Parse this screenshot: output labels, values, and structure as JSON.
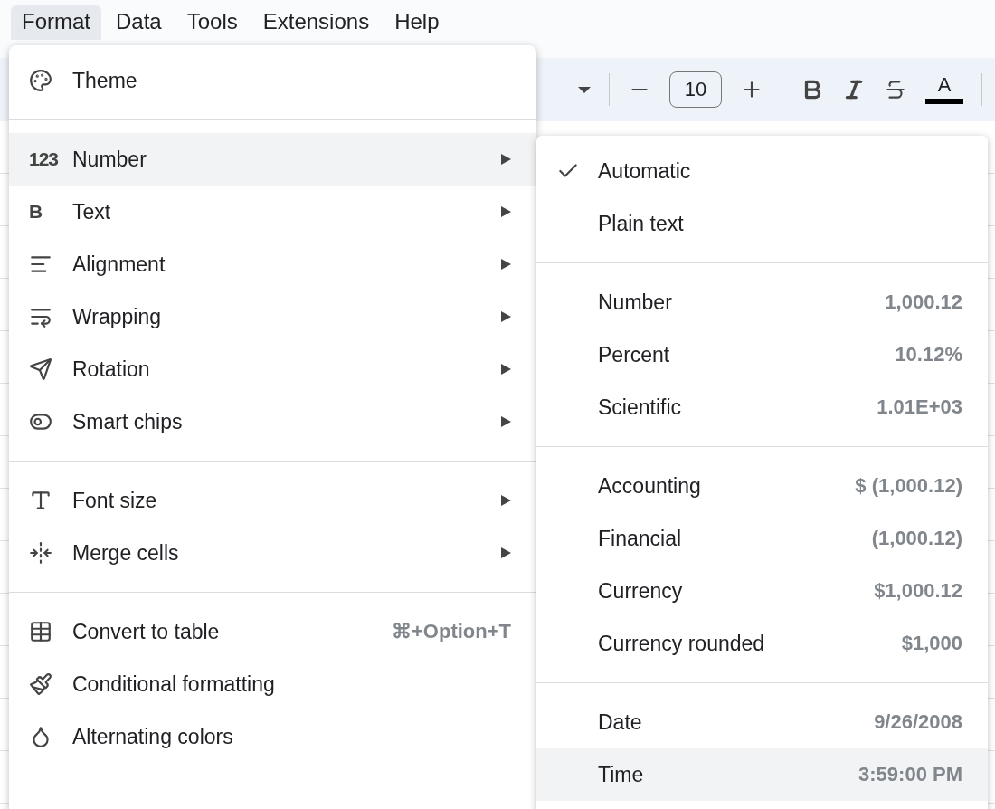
{
  "menubar": [
    {
      "label": "Format",
      "selected": true
    },
    {
      "label": "Data",
      "selected": false
    },
    {
      "label": "Tools",
      "selected": false
    },
    {
      "label": "Extensions",
      "selected": false
    },
    {
      "label": "Help",
      "selected": false
    }
  ],
  "toolbar": {
    "font_size": "10",
    "text_color_letter": "A"
  },
  "menu": {
    "groups": [
      [
        {
          "label": "Theme",
          "submenu": false,
          "highlighted": false
        }
      ],
      [
        {
          "label": "Number",
          "icon_text": "123",
          "submenu": true,
          "highlighted": true
        },
        {
          "label": "Text",
          "icon_text": "B",
          "submenu": true,
          "highlighted": false
        },
        {
          "label": "Alignment",
          "submenu": true,
          "highlighted": false
        },
        {
          "label": "Wrapping",
          "submenu": true,
          "highlighted": false
        },
        {
          "label": "Rotation",
          "submenu": true,
          "highlighted": false
        },
        {
          "label": "Smart chips",
          "submenu": true,
          "highlighted": false
        }
      ],
      [
        {
          "label": "Font size",
          "submenu": true,
          "highlighted": false
        },
        {
          "label": "Merge cells",
          "submenu": true,
          "highlighted": false
        }
      ],
      [
        {
          "label": "Convert to table",
          "shortcut": "⌘+Option+T",
          "submenu": false,
          "highlighted": false
        },
        {
          "label": "Conditional formatting",
          "submenu": false,
          "highlighted": false
        },
        {
          "label": "Alternating colors",
          "submenu": false,
          "highlighted": false
        }
      ]
    ]
  },
  "submenu": {
    "groups": [
      [
        {
          "label": "Automatic",
          "checked": true,
          "highlighted": false
        },
        {
          "label": "Plain text",
          "checked": false,
          "highlighted": false
        }
      ],
      [
        {
          "label": "Number",
          "example": "1,000.12",
          "checked": false,
          "highlighted": false
        },
        {
          "label": "Percent",
          "example": "10.12%",
          "checked": false,
          "highlighted": false
        },
        {
          "label": "Scientific",
          "example": "1.01E+03",
          "checked": false,
          "highlighted": false
        }
      ],
      [
        {
          "label": "Accounting",
          "example": "$ (1,000.12)",
          "checked": false,
          "highlighted": false
        },
        {
          "label": "Financial",
          "example": "(1,000.12)",
          "checked": false,
          "highlighted": false
        },
        {
          "label": "Currency",
          "example": "$1,000.12",
          "checked": false,
          "highlighted": false
        },
        {
          "label": "Currency rounded",
          "example": "$1,000",
          "checked": false,
          "highlighted": false
        }
      ],
      [
        {
          "label": "Date",
          "example": "9/26/2008",
          "checked": false,
          "highlighted": false
        },
        {
          "label": "Time",
          "example": "3:59:00 PM",
          "checked": false,
          "highlighted": true
        }
      ]
    ]
  }
}
